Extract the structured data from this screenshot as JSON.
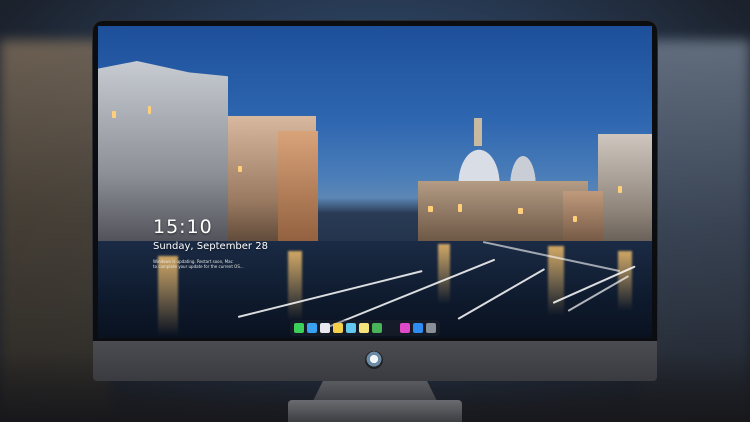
{
  "lockscreen": {
    "time": "15:10",
    "date": "Sunday, September 28",
    "notice_line1": "Windows is updating. Restart soon, Mac",
    "notice_line2": "to complete your update for the current OS..."
  },
  "dock": {
    "icons": [
      {
        "name": "messages-icon",
        "color": "#3ccf5a"
      },
      {
        "name": "finder-icon",
        "color": "#3aa0f0"
      },
      {
        "name": "safari-icon",
        "color": "#e8e8ee"
      },
      {
        "name": "notes-icon",
        "color": "#f5d04a"
      },
      {
        "name": "photos-icon",
        "color": "#62c8f0"
      },
      {
        "name": "stickies-icon",
        "color": "#f4e27a"
      },
      {
        "name": "preview-icon",
        "color": "#49b35a"
      },
      {
        "name": "itunes-icon",
        "color": "#e04ac8"
      },
      {
        "name": "app-store-icon",
        "color": "#2e8cf0"
      },
      {
        "name": "camera-icon",
        "color": "#8a8f98"
      }
    ]
  },
  "colors": {
    "sky_top": "#1d4f9a",
    "bezel": "#0c0d10",
    "chin": "#4b4c52"
  }
}
